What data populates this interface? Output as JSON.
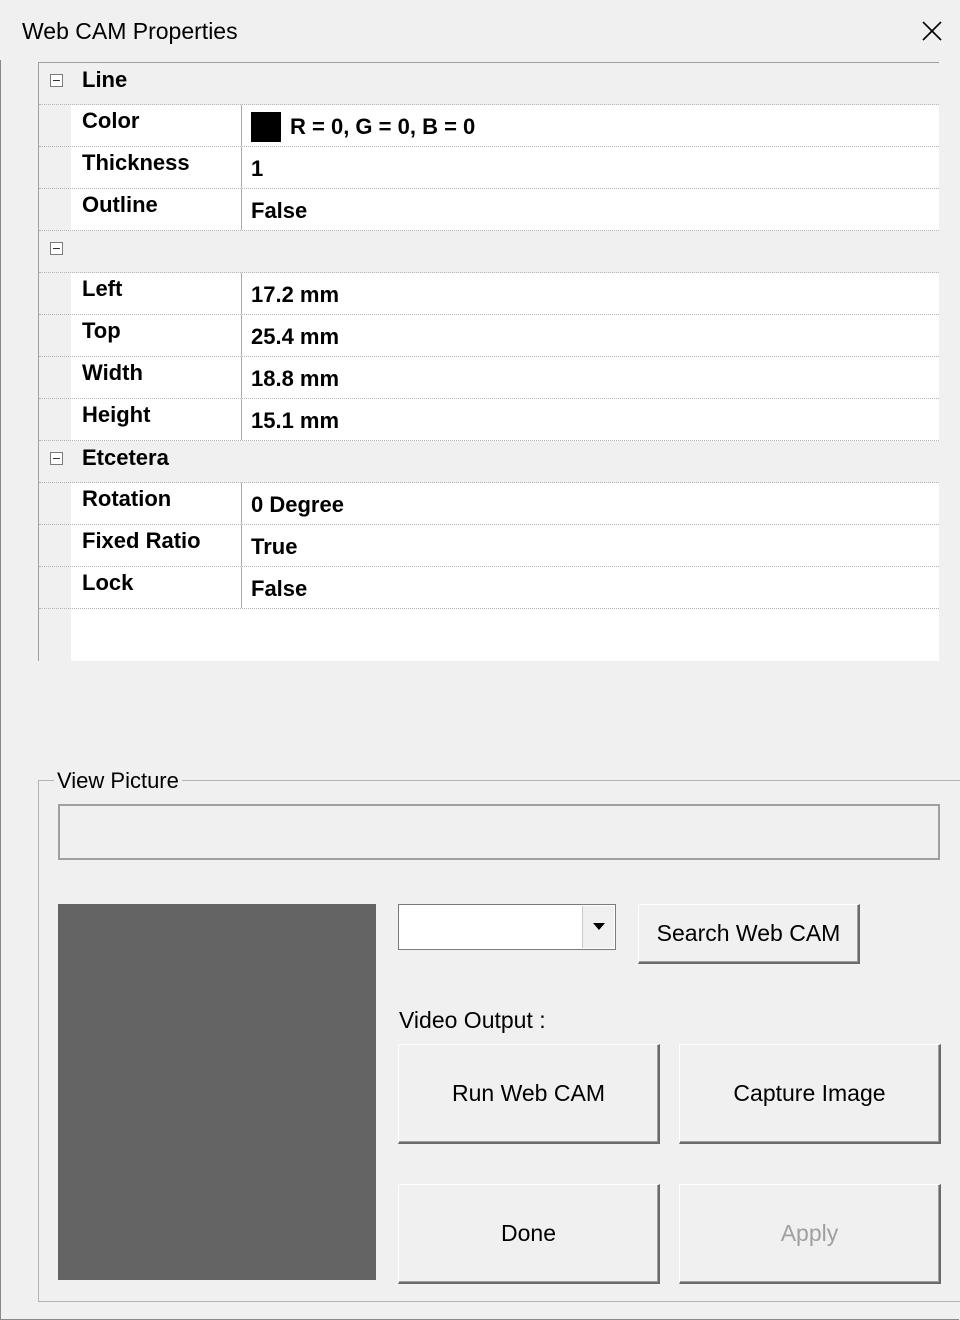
{
  "window": {
    "title": "Web CAM Properties"
  },
  "grid": {
    "categories": [
      {
        "label": "Line",
        "rows": [
          {
            "name": "Color",
            "value": "R = 0, G = 0, B = 0",
            "swatch": "#000000"
          },
          {
            "name": "Thickness",
            "value": "1"
          },
          {
            "name": "Outline",
            "value": "False"
          }
        ]
      },
      {
        "label": "",
        "rows": [
          {
            "name": "Left",
            "value": "17.2 mm"
          },
          {
            "name": "Top",
            "value": "25.4 mm"
          },
          {
            "name": "Width",
            "value": "18.8 mm"
          },
          {
            "name": "Height",
            "value": "15.1 mm"
          }
        ]
      },
      {
        "label": "Etcetera",
        "rows": [
          {
            "name": "Rotation",
            "value": "0 Degree"
          },
          {
            "name": "Fixed Ratio",
            "value": "True"
          },
          {
            "name": "Lock",
            "value": "False"
          }
        ]
      }
    ]
  },
  "view_picture": {
    "legend": "View Picture",
    "path_value": "",
    "camera_select_value": "",
    "search_button": "Search Web CAM",
    "video_output_label": "Video Output :",
    "run_button": "Run Web CAM",
    "capture_button": "Capture Image",
    "done_button": "Done",
    "apply_button": "Apply"
  },
  "colors": {
    "preview_bg": "#646464",
    "window_bg": "#f0f0f0"
  }
}
